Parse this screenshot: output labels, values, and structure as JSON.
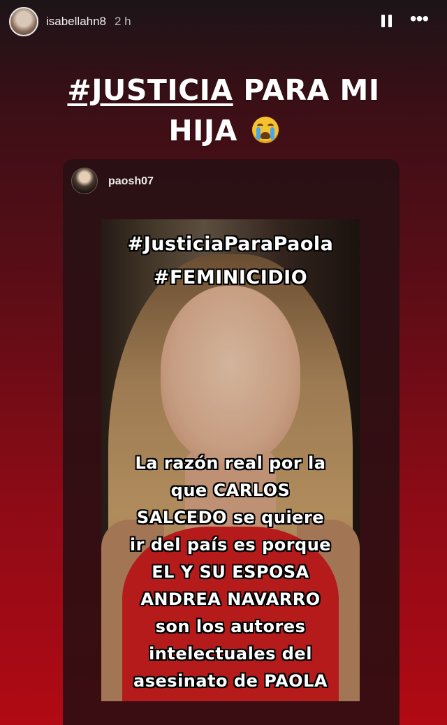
{
  "story_header": {
    "username": "isabellahn8",
    "time": "2 h",
    "pause_icon": "pause-icon",
    "more_icon": "more-icon"
  },
  "title": {
    "hashtag": "#JUSTICIA",
    "rest_line1": " PARA MI",
    "line2": "HIJA",
    "emoji": "loudly-crying-face-emoji"
  },
  "reshared_post": {
    "username": "paosh07",
    "image_text": {
      "hashtag1": "#JusticiaParaPaola",
      "hashtag2": "#FEMINICIDIO",
      "lines": [
        "La razón real por la",
        "que CARLOS",
        "SALCEDO se quiere",
        "ir del país es porque",
        "EL Y SU ESPOSA",
        "ANDREA NAVARRO",
        "son los autores",
        "intelectuales del",
        "asesinato de PAOLA"
      ]
    }
  }
}
